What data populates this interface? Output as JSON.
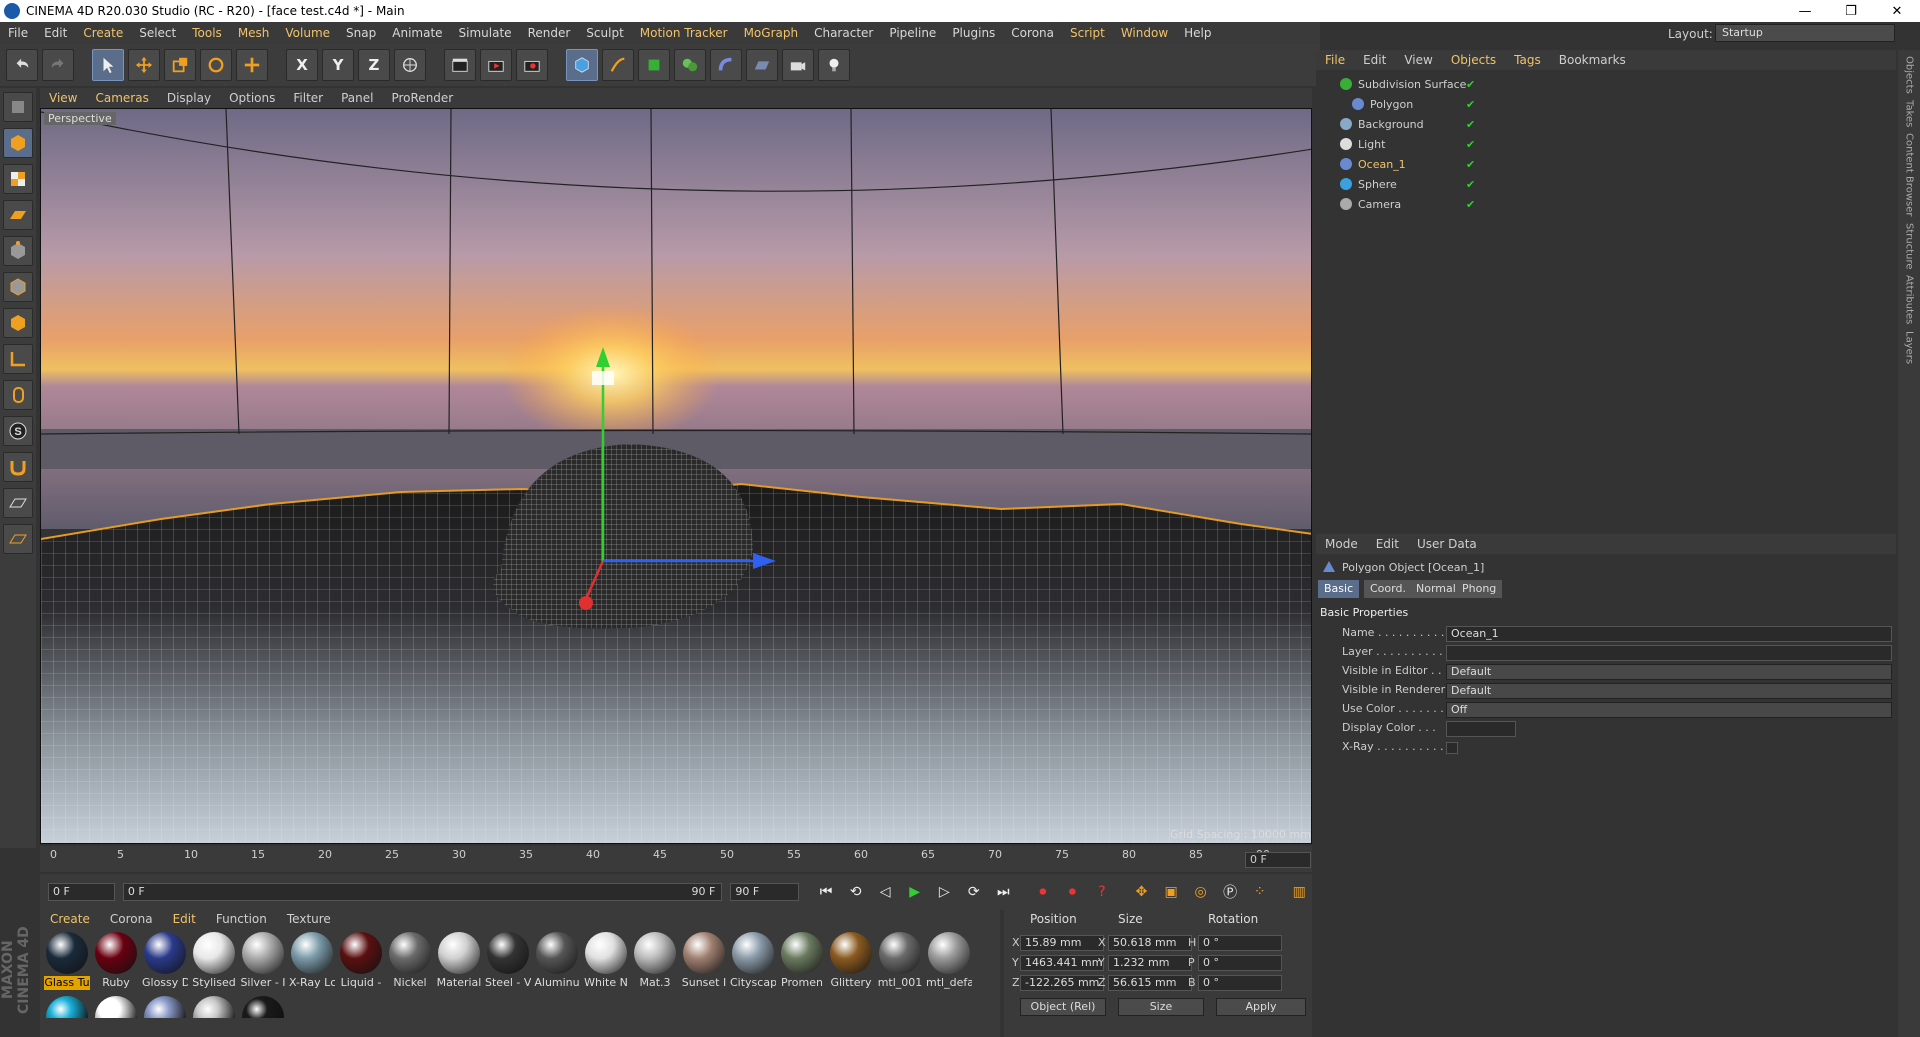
{
  "window": {
    "title": "CINEMA 4D R20.030 Studio (RC - R20) - [face test.c4d *] - Main",
    "controls": [
      "—",
      "❐",
      "✕"
    ]
  },
  "menubar": {
    "items": [
      "File",
      "Edit",
      "Create",
      "Select",
      "Tools",
      "Mesh",
      "Volume",
      "Snap",
      "Animate",
      "Simulate",
      "Render",
      "Sculpt",
      "Motion Tracker",
      "MoGraph",
      "Character",
      "Pipeline",
      "Plugins",
      "Corona",
      "Script",
      "Window",
      "Help"
    ],
    "highlighted": [
      "Create",
      "Tools",
      "Mesh",
      "Volume",
      "Motion Tracker",
      "MoGraph",
      "Script",
      "Window"
    ]
  },
  "layout": {
    "label": "Layout:",
    "value": "Startup"
  },
  "toolbar": {
    "axis_x": "X",
    "axis_y": "Y",
    "axis_z": "Z"
  },
  "viewport": {
    "menu": [
      "View",
      "Cameras",
      "Display",
      "Options",
      "Filter",
      "Panel",
      "ProRender"
    ],
    "highlighted": [
      "View",
      "Cameras"
    ],
    "label": "Perspective",
    "grid_info": "Grid Spacing : 10000 mm"
  },
  "timeline": {
    "ticks": [
      "0",
      "5",
      "10",
      "15",
      "20",
      "25",
      "30",
      "35",
      "40",
      "45",
      "50",
      "55",
      "60",
      "65",
      "70",
      "75",
      "80",
      "85",
      "90"
    ],
    "current_frame_field": "0 F"
  },
  "playbar": {
    "start": "0 F",
    "range_start": "0 F",
    "range_end": "90 F",
    "end": "90 F"
  },
  "materials": {
    "menu": [
      "Create",
      "Corona",
      "Edit",
      "Function",
      "Texture"
    ],
    "highlighted": [
      "Create",
      "Edit"
    ],
    "items": [
      {
        "name": "Glass Tu",
        "color": "#1a2a3a",
        "selected": true
      },
      {
        "name": "Ruby",
        "color": "#6a0010"
      },
      {
        "name": "Glossy D",
        "color": "#2a3a8a"
      },
      {
        "name": "Stylised",
        "color": "#e8e8e8"
      },
      {
        "name": "Silver - I",
        "color": "#aaaaaa"
      },
      {
        "name": "X-Ray Lc",
        "color": "#7a9aa8"
      },
      {
        "name": "Liquid -",
        "color": "#5a1010"
      },
      {
        "name": "Nickel",
        "color": "#6a6a6a"
      },
      {
        "name": "Material",
        "color": "#d0d0d0"
      },
      {
        "name": "Steel - V",
        "color": "#333333"
      },
      {
        "name": "Aluminu",
        "color": "#555555"
      },
      {
        "name": "White N",
        "color": "#e0e0e0"
      },
      {
        "name": "Mat.3",
        "color": "#bbbbbb"
      },
      {
        "name": "Sunset I",
        "color": "#a08070"
      },
      {
        "name": "Cityscap",
        "color": "#8a9aa8"
      },
      {
        "name": "Promen",
        "color": "#6a7a60"
      },
      {
        "name": "Glittery",
        "color": "#8a5a20"
      },
      {
        "name": "mtl_001",
        "color": "#6a6a6a"
      },
      {
        "name": "mtl_defa",
        "color": "#9a9a9a"
      }
    ],
    "row2": [
      "#18b0d8",
      "#ffffff",
      "#8a9ac8",
      "#c8c8c8",
      "#1a1a1a"
    ]
  },
  "coords": {
    "headers": [
      "Position",
      "Size",
      "Rotation"
    ],
    "axes": [
      "X",
      "Y",
      "Z"
    ],
    "rot_axes": [
      "H",
      "P",
      "B"
    ],
    "position": [
      "15.89 mm",
      "1463.441 mm",
      "-122.265 mm"
    ],
    "size": [
      "50.618 mm",
      "1.232 mm",
      "56.615 mm"
    ],
    "rotation": [
      "0 °",
      "0 °",
      "0 °"
    ],
    "mode": "Object (Rel)",
    "size_mode": "Size",
    "apply": "Apply"
  },
  "objects": {
    "menu": [
      "File",
      "Edit",
      "View",
      "Objects",
      "Tags",
      "Bookmarks"
    ],
    "highlighted": [
      "File",
      "Objects",
      "Tags"
    ],
    "rows": [
      {
        "name": "Subdivision Surface",
        "color": "#38b038",
        "indent": 0,
        "hl": false
      },
      {
        "name": "Polygon",
        "color": "#6a8ad0",
        "indent": 1,
        "hl": false
      },
      {
        "name": "Background",
        "color": "#8aa8c8",
        "indent": 0,
        "hl": false
      },
      {
        "name": "Light",
        "color": "#dddddd",
        "indent": 0,
        "hl": false
      },
      {
        "name": "Ocean_1",
        "color": "#6a8ad0",
        "indent": 0,
        "hl": true
      },
      {
        "name": "Sphere",
        "color": "#3aa0e0",
        "indent": 0,
        "hl": false
      },
      {
        "name": "Camera",
        "color": "#aaaaaa",
        "indent": 0,
        "hl": false
      }
    ]
  },
  "attributes": {
    "menu": [
      "Mode",
      "Edit",
      "User Data"
    ],
    "title": "Polygon Object [Ocean_1]",
    "tabs": [
      "Basic",
      "Coord.",
      "Normal",
      "Phong"
    ],
    "section": "Basic Properties",
    "fields": [
      {
        "label": "Name . . . . . . . . . . .",
        "value": "Ocean_1",
        "type": "text"
      },
      {
        "label": "Layer . . . . . . . . . . .",
        "value": "",
        "type": "text"
      },
      {
        "label": "Visible in Editor . . .",
        "value": "Default",
        "type": "select"
      },
      {
        "label": "Visible in Renderer",
        "value": "Default",
        "type": "select"
      },
      {
        "label": "Use Color . . . . . . .",
        "value": "Off",
        "type": "select"
      },
      {
        "label": "Display Color . . .",
        "value": "",
        "type": "color"
      },
      {
        "label": "X-Ray . . . . . . . . . .",
        "value": "",
        "type": "check"
      }
    ]
  },
  "side_tabs": [
    "Objects",
    "Takes",
    "Content Browser",
    "Structure",
    "Attributes",
    "Layers"
  ]
}
